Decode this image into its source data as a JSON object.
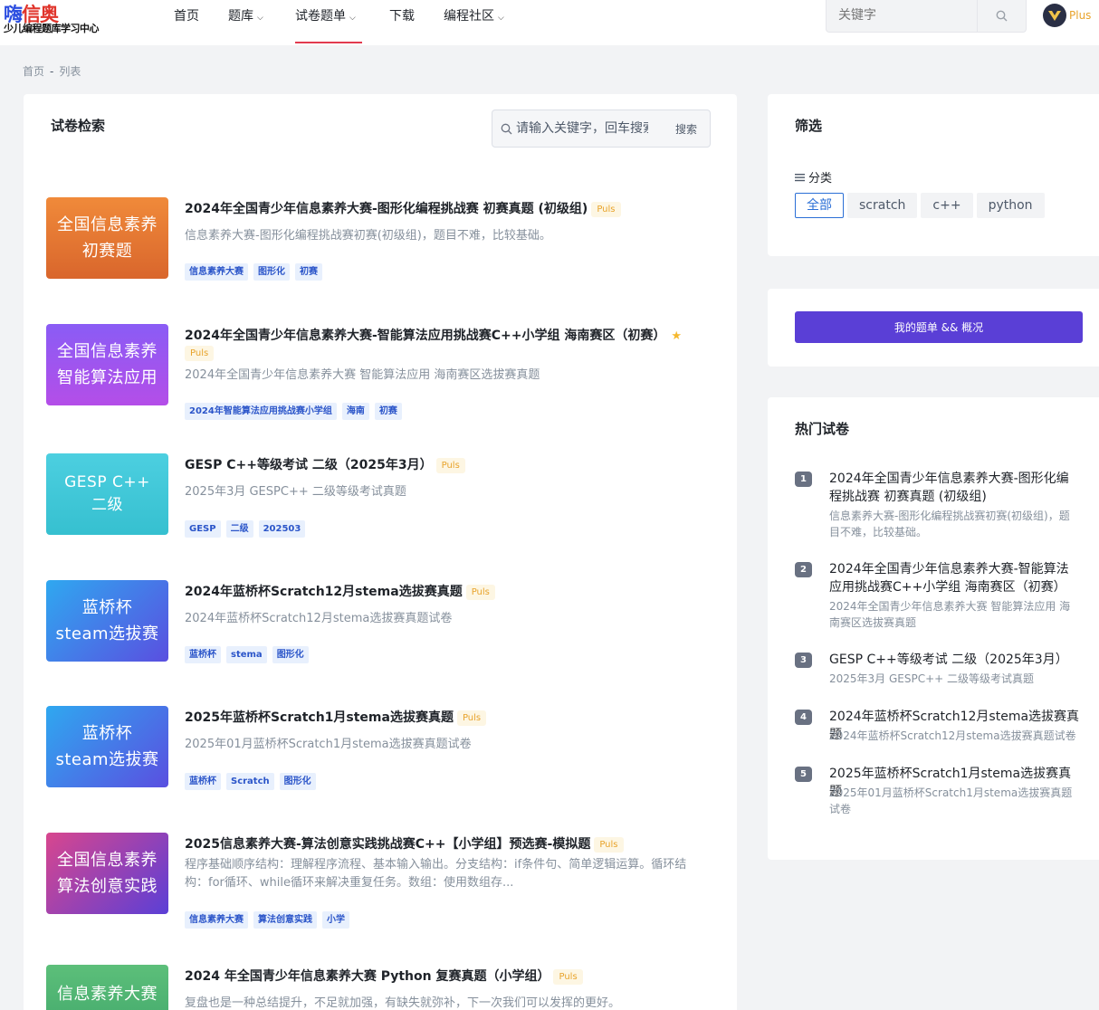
{
  "header": {
    "logo_part1": "嗨",
    "logo_part2": "信奥",
    "logo_subtitle": "少儿编程题库学习中心",
    "nav": [
      {
        "label": "首页"
      },
      {
        "label": "题库"
      },
      {
        "label": "试卷题单"
      },
      {
        "label": "下载"
      },
      {
        "label": "编程社区"
      }
    ],
    "search_placeholder": "关键字",
    "plus_label": "Plus"
  },
  "breadcrumb": {
    "home": "首页",
    "sep": "-",
    "current": "列表"
  },
  "main": {
    "title": "试卷检索",
    "search_placeholder": "请输入关键字，回车搜索",
    "search_button": "搜索",
    "puls_badge": "Puls",
    "papers": [
      {
        "cover_line1": "全国信息素养",
        "cover_line2": "初赛题",
        "title": "2024年全国青少年信息素养大赛-图形化编程挑战赛 初赛真题 (初级组)",
        "desc": "信息素养大赛-图形化编程挑战赛初赛(初级组)，题目不难，比较基础。",
        "tags": [
          "信息素养大赛",
          "图形化",
          "初赛"
        ]
      },
      {
        "cover_line1": "全国信息素养",
        "cover_line2": "智能算法应用",
        "title": "2024年全国青少年信息素养大赛-智能算法应用挑战赛C++小学组 海南赛区（初赛）",
        "desc": "2024年全国青少年信息素养大赛 智能算法应用 海南赛区选拔赛真题",
        "tags": [
          "2024年智能算法应用挑战赛小学组",
          "海南",
          "初赛"
        ]
      },
      {
        "cover_line1": "GESP C++",
        "cover_line2": "二级",
        "title": "GESP C++等级考试 二级（2025年3月）",
        "desc": "2025年3月 GESPC++ 二级等级考试真题",
        "tags": [
          "GESP",
          "二级",
          "202503"
        ]
      },
      {
        "cover_line1": "蓝桥杯",
        "cover_line2": "steam选拔赛",
        "title": "2024年蓝桥杯Scratch12月stema选拔赛真题",
        "desc": "2024年蓝桥杯Scratch12月stema选拔赛真题试卷",
        "tags": [
          "蓝桥杯",
          "stema",
          "图形化"
        ]
      },
      {
        "cover_line1": "蓝桥杯",
        "cover_line2": "steam选拔赛",
        "title": "2025年蓝桥杯Scratch1月stema选拔赛真题",
        "desc": "2025年01月蓝桥杯Scratch1月stema选拔赛真题试卷",
        "tags": [
          "蓝桥杯",
          "Scratch",
          "图形化"
        ]
      },
      {
        "cover_line1": "全国信息素养",
        "cover_line2": "算法创意实践",
        "title": "2025信息素养大赛-算法创意实践挑战赛C++【小学组】预选赛-模拟题",
        "desc": "程序基础顺序结构：理解程序流程、基本输入输出。分支结构：if条件句、简单逻辑运算。循环结构：for循环、while循环来解决重复任务。数组：使用数组存...",
        "tags": [
          "信息素养大赛",
          "算法创意实践",
          "小学"
        ]
      },
      {
        "cover_line1": "信息素养大赛",
        "cover_line2": "",
        "title": "2024 年全国青少年信息素养大赛 Python 复赛真题（小学组）",
        "desc": "复盘也是一种总结提升，不足就加强，有缺失就弥补，下一次我们可以发挥的更好。",
        "tags": []
      }
    ]
  },
  "filter": {
    "title": "筛选",
    "category_label": "分类",
    "options": [
      "全部",
      "scratch",
      "c++",
      "python"
    ]
  },
  "my_button": "我的题单 && 概况",
  "hot": {
    "title": "热门试卷",
    "items": [
      {
        "num": "1",
        "title": "2024年全国青少年信息素养大赛-图形化编程挑战赛 初赛真题 (初级组)",
        "desc": "信息素养大赛-图形化编程挑战赛初赛(初级组)，题目不难，比较基础。"
      },
      {
        "num": "2",
        "title": "2024年全国青少年信息素养大赛-智能算法应用挑战赛C++小学组 海南赛区（初赛）",
        "desc": "2024年全国青少年信息素养大赛 智能算法应用 海南赛区选拔赛真题"
      },
      {
        "num": "3",
        "title": "GESP C++等级考试 二级（2025年3月）",
        "desc": "2025年3月 GESPC++ 二级等级考试真题"
      },
      {
        "num": "4",
        "title": "2024年蓝桥杯Scratch12月stema选拔赛真题",
        "desc": "2024年蓝桥杯Scratch12月stema选拔赛真题试卷"
      },
      {
        "num": "5",
        "title": "2025年蓝桥杯Scratch1月stema选拔赛真题",
        "desc": "2025年01月蓝桥杯Scratch1月stema选拔赛真题试卷"
      }
    ]
  },
  "colors": {
    "accent_purple": "#5a3fd6",
    "nav_active": "#e23a4e",
    "tag_blue": "#2b55c9",
    "puls_gold": "#e8a32b"
  }
}
